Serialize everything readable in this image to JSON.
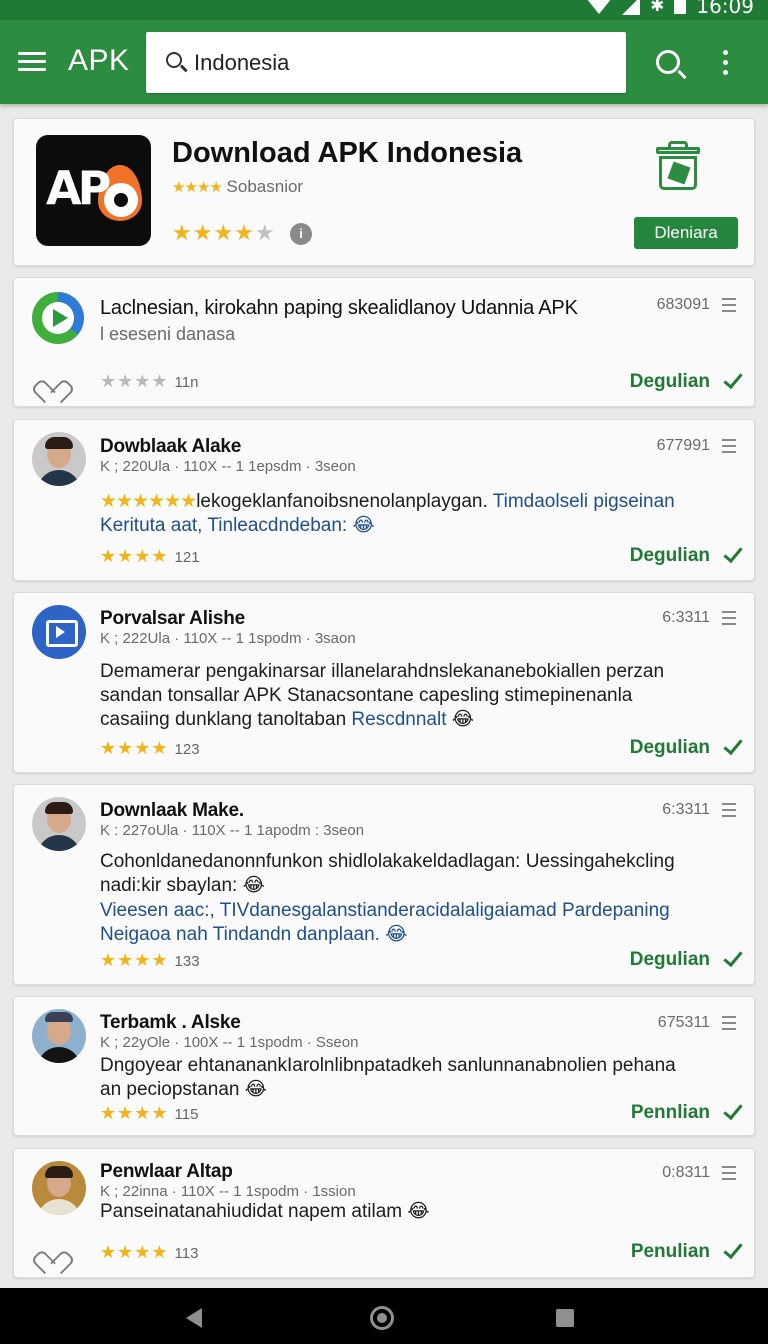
{
  "status_bar": {
    "time": "16:09"
  },
  "app_bar": {
    "title": "APK",
    "search_value": "Indonesia"
  },
  "featured": {
    "title": "Download APK Indonesia",
    "logo_text": "AP",
    "sub_stars": "★★★★",
    "sub_label": "Sobasnior",
    "rating_on": "★★★★",
    "rating_off": "★",
    "info_glyph": "i",
    "button_label": "Dleniara"
  },
  "items": [
    {
      "title": "Laclnesian, kirokahn paping skealidlanoy Udannia APK",
      "meta": "l eseseni danasa",
      "stars_on": "",
      "stars_off": "★★★★",
      "count": "11n",
      "number": "683091",
      "action": "Degulian"
    },
    {
      "title": "Dowblaak Alake",
      "meta": "K ; 220Ula · 110X -- 1 1epsdm · 3seon",
      "text_stars": "★★★★★★",
      "text": "lekogeklanfanoibsnenolanplaygan.",
      "text_blue_inline": "Timdaolseli pigseinan",
      "text_blue": "Keritutа aat, Tinleacdndeban:",
      "emoji": "😂",
      "stars_on": "★★★★",
      "count": "121",
      "number": "677991",
      "action": "Degulian"
    },
    {
      "title": "Porvalsar Alishe",
      "meta": "K ; 222Ula · 110X -- 1 1spodm · 3sаon",
      "text_line1": "Demamerar pengakinarsar illanelarahdnslekananebokiallen perzan",
      "text_line2": "sandan tonsallar APK Stanacsontane capesling stimepinenanla",
      "text_line3": "casaiing dunklang tanoltaban",
      "text_blue_inline": "Rescdnnalt",
      "emoji": "😂",
      "stars_on": "★★★★",
      "count": "123",
      "number": "6:3311",
      "action": "Degulian"
    },
    {
      "title": "Downlaak Make.",
      "meta": "K : 227oUla · 110X -- 1 1apodm : 3seon",
      "text_line1": "Cohonldanedanonnfunkon shidlolakakeldadlagan: Uessingahekcling",
      "text_line2": "nadi:kir sbaylan:",
      "text_blue1": "Vieesen aac:, TIVdanesgalanstianderacidalaligaiamad Pardepaning",
      "text_blue2": "Neigaoa nah Tindandn danplaan.",
      "emoji": "😂",
      "stars_on": "★★★★",
      "count": "133",
      "number": "6:3311",
      "action": "Degulian"
    },
    {
      "title": "Terbamk . Alske",
      "meta": "K ; 22yOle · 100X -- 1 1spodm · Sseon",
      "text_line1": "Dngoyear ehtananankIarolnlibnpatadkeh sanlunnanabnolien pehana",
      "text_line2": "an peciopstanan",
      "emoji": "😂",
      "stars_on": "★★★★",
      "count": "115",
      "number": "675311",
      "action": "Pennlian"
    },
    {
      "title": "Penwlaar Altap",
      "meta": "K ; 22inna · 110X -- 1 1spodm · 1ssion",
      "text_line1": "Panseinatanahiudidat napem atilam",
      "emoji": "😂",
      "stars_on": "★★★★",
      "count": "113",
      "number": "0:8311",
      "action": "Penulian"
    }
  ]
}
